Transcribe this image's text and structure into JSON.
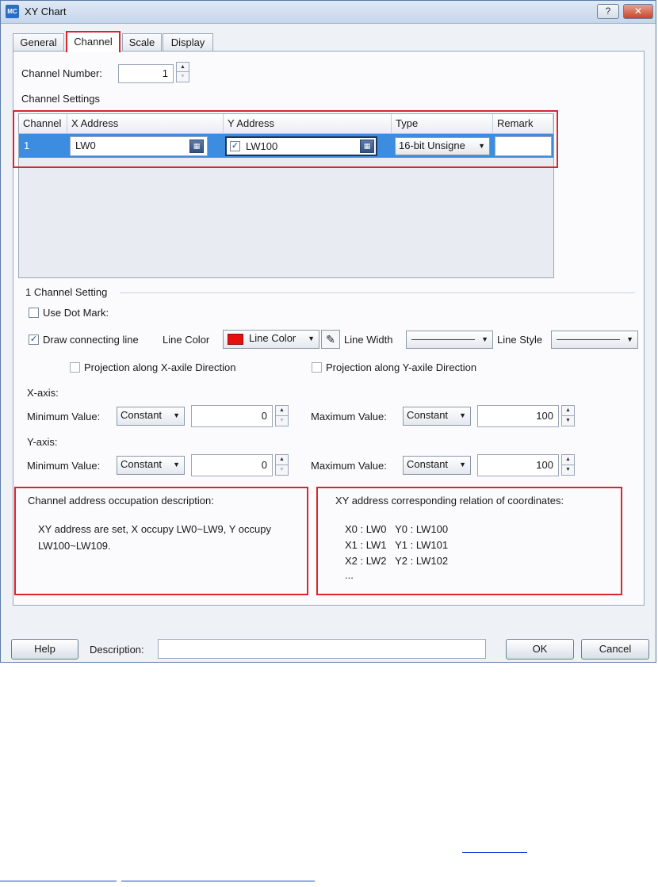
{
  "window": {
    "app_icon_text": "MC",
    "title": "XY Chart",
    "help_glyph": "?",
    "close_glyph": "✕"
  },
  "tabs": [
    "General",
    "Channel",
    "Scale",
    "Display"
  ],
  "active_tab": "Channel",
  "channel_number": {
    "label": "Channel Number:",
    "value": "1"
  },
  "channel_settings": {
    "label": "Channel Settings",
    "columns": [
      "Channel",
      "X Address",
      "Y Address",
      "Type",
      "Remark"
    ],
    "rows": [
      {
        "channel": "1",
        "x_address": "LW0",
        "y_address_checked": true,
        "y_address": "LW100",
        "type": "16-bit Unsigne",
        "remark": ""
      }
    ]
  },
  "single_channel": {
    "title": "1 Channel Setting",
    "use_dot_mark": {
      "label": "Use Dot Mark:",
      "checked": false
    },
    "draw_connecting_line": {
      "label": "Draw connecting line",
      "checked": true
    },
    "line_color_label": "Line Color",
    "line_color_value": "Line Color",
    "line_color_hex": "#e8100f",
    "line_width_label": "Line Width",
    "line_style_label": "Line Style",
    "projection_x": {
      "label": "Projection along X-axile Direction",
      "checked": false
    },
    "projection_y": {
      "label": "Projection along Y-axile Direction",
      "checked": false
    }
  },
  "x_axis": {
    "label": "X-axis:",
    "min_label": "Minimum Value:",
    "min_mode": "Constant",
    "min_value": "0",
    "max_label": "Maximum Value:",
    "max_mode": "Constant",
    "max_value": "100"
  },
  "y_axis": {
    "label": "Y-axis:",
    "min_label": "Minimum Value:",
    "min_mode": "Constant",
    "min_value": "0",
    "max_label": "Maximum Value:",
    "max_mode": "Constant",
    "max_value": "100"
  },
  "occupation": {
    "title": "Channel address occupation description:",
    "line1": "XY address are set, X occupy LW0~LW9, Y occupy",
    "line2": "LW100~LW109."
  },
  "relation": {
    "title": "XY address corresponding relation of coordinates:",
    "lines": [
      "X0 : LW0   Y0 : LW100",
      "X1 : LW1   Y1 : LW101",
      "X2 : LW2   Y2 : LW102",
      "..."
    ]
  },
  "footer": {
    "help": "Help",
    "description_label": "Description:",
    "description_value": "",
    "ok": "OK",
    "cancel": "Cancel"
  },
  "colors": {
    "accent_red": "#d9252e",
    "selection_blue": "#3c8ce0"
  }
}
